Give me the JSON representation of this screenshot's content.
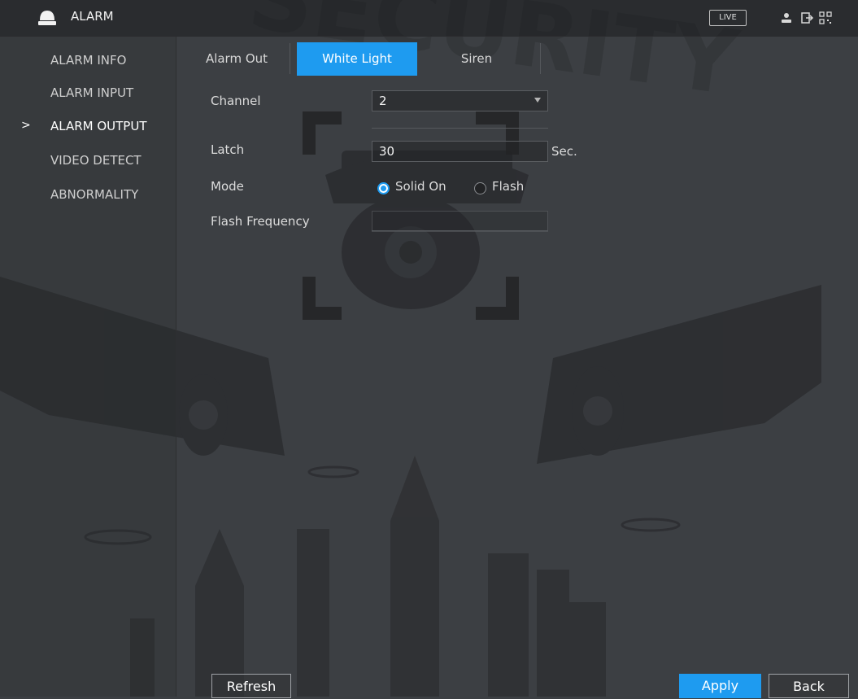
{
  "header": {
    "title": "ALARM",
    "live_label": "LIVE",
    "icons": [
      "alarm-device-icon",
      "user-icon",
      "logout-icon",
      "qr-code-icon"
    ]
  },
  "sidebar": {
    "items": [
      {
        "label": "ALARM INFO",
        "active": false
      },
      {
        "label": "ALARM INPUT",
        "active": false
      },
      {
        "label": "ALARM OUTPUT",
        "active": true
      },
      {
        "label": "VIDEO DETECT",
        "active": false
      },
      {
        "label": "ABNORMALITY",
        "active": false
      }
    ],
    "active_marker": ">"
  },
  "tabs": [
    {
      "label": "Alarm Out",
      "active": false
    },
    {
      "label": "White Light",
      "active": true
    },
    {
      "label": "Siren",
      "active": false
    }
  ],
  "form": {
    "channel_label": "Channel",
    "channel_value": "2",
    "latch_label": "Latch",
    "latch_value": "30",
    "latch_unit": "Sec.",
    "mode_label": "Mode",
    "mode_options": [
      {
        "label": "Solid On",
        "selected": true
      },
      {
        "label": "Flash",
        "selected": false
      }
    ],
    "flash_frequency_label": "Flash Frequency",
    "flash_frequency_value": ""
  },
  "buttons": {
    "refresh": "Refresh",
    "apply": "Apply",
    "back": "Back"
  },
  "colors": {
    "accent": "#1e9bf0",
    "background": "#3c3f43"
  }
}
